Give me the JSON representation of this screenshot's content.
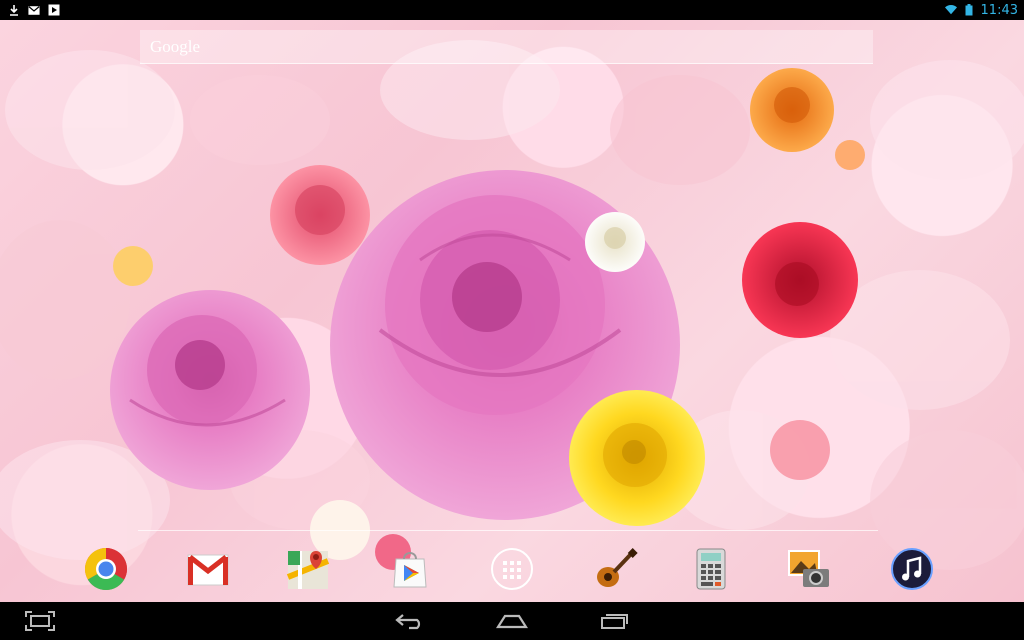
{
  "status_bar": {
    "time": "11:43",
    "left_icons": [
      "download-icon",
      "gmail-notification-icon",
      "media-notification-icon"
    ],
    "right_icons": [
      "wifi-icon",
      "battery-icon"
    ],
    "accent_color": "#33b5e5"
  },
  "search": {
    "label": "Google"
  },
  "wallpaper": {
    "name": "rose-live-wallpaper",
    "petal_color": "#f7c5d3",
    "flowers": [
      "pink-rose-large",
      "pink-rose-left",
      "pink-rose-small",
      "orange-rose",
      "white-rose",
      "red-rose",
      "yellow-rose",
      "pink-rose-faded"
    ]
  },
  "dock": {
    "icons": [
      "chrome-icon",
      "gmail-icon",
      "maps-icon",
      "play-store-icon",
      "app-drawer-icon",
      "guitar-app-icon",
      "calculator-icon",
      "gallery-icon",
      "music-icon"
    ]
  },
  "nav_bar": {
    "buttons": [
      "screenshot-icon",
      "back-icon",
      "home-icon",
      "recents-icon"
    ]
  }
}
